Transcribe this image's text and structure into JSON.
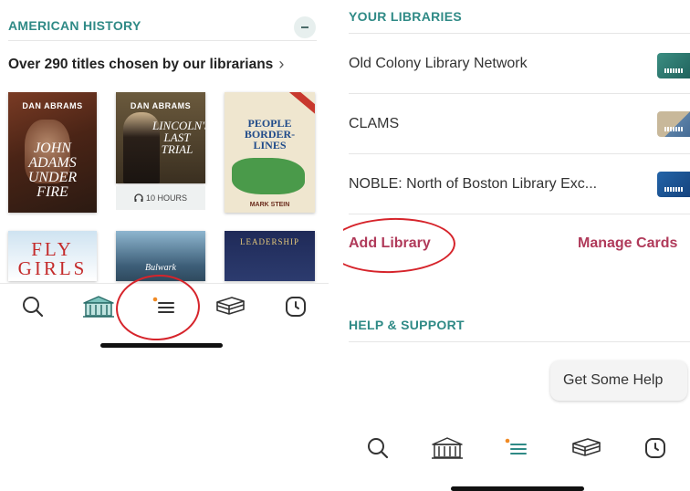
{
  "left": {
    "section_title": "AMERICAN HISTORY",
    "titles_link": "Over 290 titles chosen by our librarians",
    "books": [
      {
        "author": "DAN ABRAMS",
        "title": "JOHN ADAMS UNDER FIRE"
      },
      {
        "author": "DAN ABRAMS",
        "title": "LINCOLN'S LAST TRIAL"
      },
      {
        "author": "",
        "title": "PEOPLE BORDER- LINES",
        "byline": "MARK STEIN"
      },
      {
        "author": "",
        "title": "FLY GIRLS"
      },
      {
        "author": "",
        "title": "Bulwark"
      },
      {
        "author": "",
        "title": "LEADERSHIP"
      }
    ],
    "audio_badge": "10 HOURS",
    "tabs": [
      "search-icon",
      "library-icon",
      "menu-icon",
      "shelf-icon",
      "clock-icon"
    ]
  },
  "right": {
    "libraries_title": "YOUR LIBRARIES",
    "libraries": [
      {
        "name": "Old Colony Library Network"
      },
      {
        "name": "CLAMS"
      },
      {
        "name": "NOBLE: North of Boston Library Exc..."
      }
    ],
    "add_library": "Add Library",
    "manage_cards": "Manage Cards",
    "help_title": "HELP & SUPPORT",
    "help_button": "Get Some Help",
    "tabs": [
      "search-icon",
      "library-icon",
      "menu-icon",
      "shelf-icon",
      "clock-icon"
    ]
  },
  "colors": {
    "teal": "#2f8a86",
    "accent_link": "#b03a5a",
    "annotation_red": "#d6242b",
    "notification_dot": "#f08a24"
  }
}
